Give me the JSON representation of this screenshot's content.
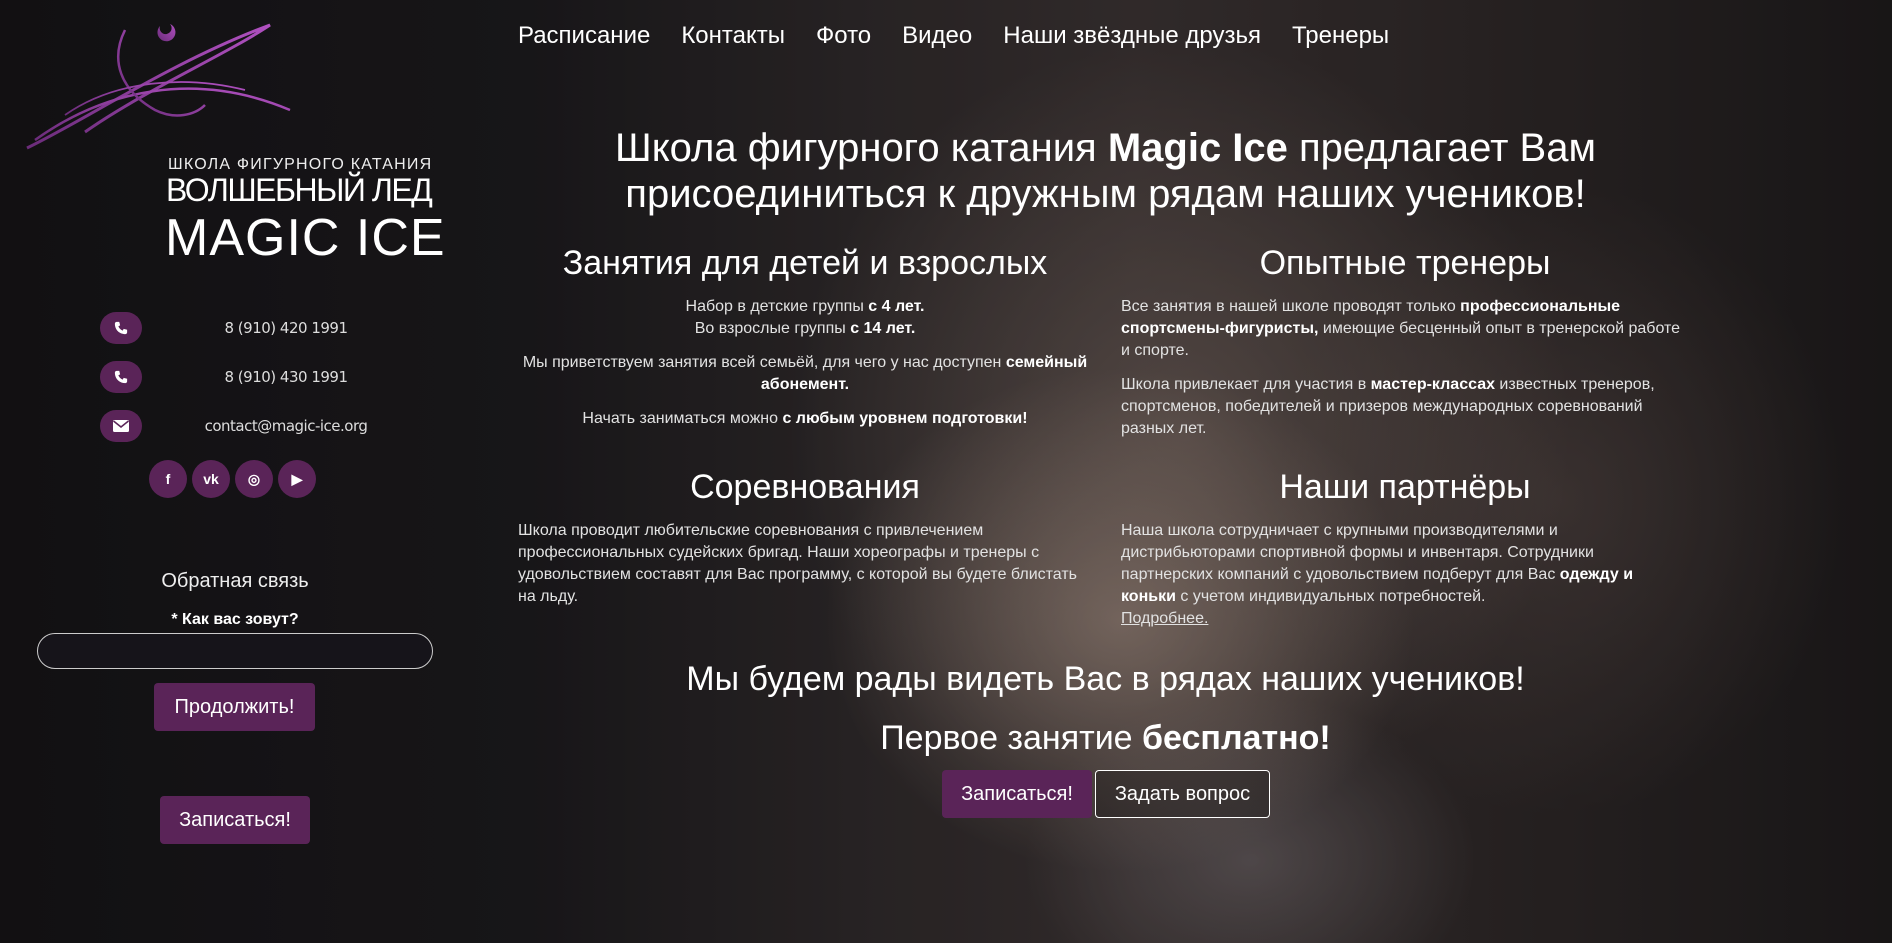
{
  "nav": [
    "Расписание",
    "Контакты",
    "Фото",
    "Видео",
    "Наши звёздные друзья",
    "Тренеры"
  ],
  "logo": {
    "line1": "ШКОЛА ФИГУРНОГО КАТАНИЯ",
    "line2": "ВОЛШЕБНЫЙ ЛЕД",
    "line3": "MAGIC ICE"
  },
  "contacts": [
    {
      "icon": "phone-icon",
      "text": "8 (910) 420 1991"
    },
    {
      "icon": "phone-icon",
      "text": "8 (910) 430 1991"
    },
    {
      "icon": "envelope-icon",
      "text": "contact@magic-ice.org"
    }
  ],
  "socials": [
    {
      "icon": "facebook-icon",
      "glyph": "f"
    },
    {
      "icon": "vk-icon",
      "glyph": "vk"
    },
    {
      "icon": "instagram-icon",
      "glyph": "◎"
    },
    {
      "icon": "youtube-icon",
      "glyph": "▶"
    }
  ],
  "feedback": {
    "title": "Обратная связь",
    "name_label": "* Как вас зовут?",
    "name_value": "",
    "continue_label": "Продолжить!",
    "signup_label": "Записаться!"
  },
  "headline": {
    "pre": "Школа фигурного катания ",
    "brand": "Magic Ice",
    "post": " предлагает Вам присоединиться к дружным рядам наших учеников!"
  },
  "sections": {
    "classes": {
      "title": "Занятия для детей и взрослых",
      "l1_pre": "Набор в детские группы ",
      "l1_b": "с 4 лет.",
      "l2_pre": "Во взрослые группы ",
      "l2_b": "с 14 лет.",
      "p2_pre": "Мы приветствуем занятия всей семьёй, для чего у нас доступен ",
      "p2_b": "семейный абонемент.",
      "p3_pre": "Начать заниматься можно ",
      "p3_b": "с любым уровнем подготовки!"
    },
    "coaches": {
      "title": "Опытные тренеры",
      "p1_pre": "Все занятия в нашей школе проводят только ",
      "p1_b": "профессиональные спортсмены-фигуристы,",
      "p1_post": " имеющие бесценный опыт в тренерской работе и спорте.",
      "p2_pre": "Школа привлекает для участия в ",
      "p2_b": "мастер-классах",
      "p2_post": " известных тренеров, спортсменов, победителей и призеров международных соревнований разных лет."
    },
    "competitions": {
      "title": "Соревнования",
      "text": "Школа проводит любительские соревнования с привлечением профессиональных судейских бригад. Наши хореографы и тренеры с удовольствием составят для Вас программу, с которой вы будете блистать на льду."
    },
    "partners": {
      "title": "Наши партнёры",
      "pre": "Наша школа сотрудничает с крупными производителями и дистрибьюторами спортивной формы и инвентаря. Сотрудники партнерских компаний с удовольствием подберут для Вас ",
      "b": "одежду и коньки",
      "post": " с учетом индивидуальных потребностей.",
      "link": "Подробнее."
    }
  },
  "invite": "Мы будем рады видеть Вас в рядах наших учеников!",
  "free": {
    "pre": "Первое занятие ",
    "b": "бесплатно!"
  },
  "buttons": {
    "signup": "Записаться!",
    "ask": "Задать вопрос"
  },
  "colors": {
    "accent": "#5a2458",
    "logo_purple": "#8a3c9c"
  }
}
